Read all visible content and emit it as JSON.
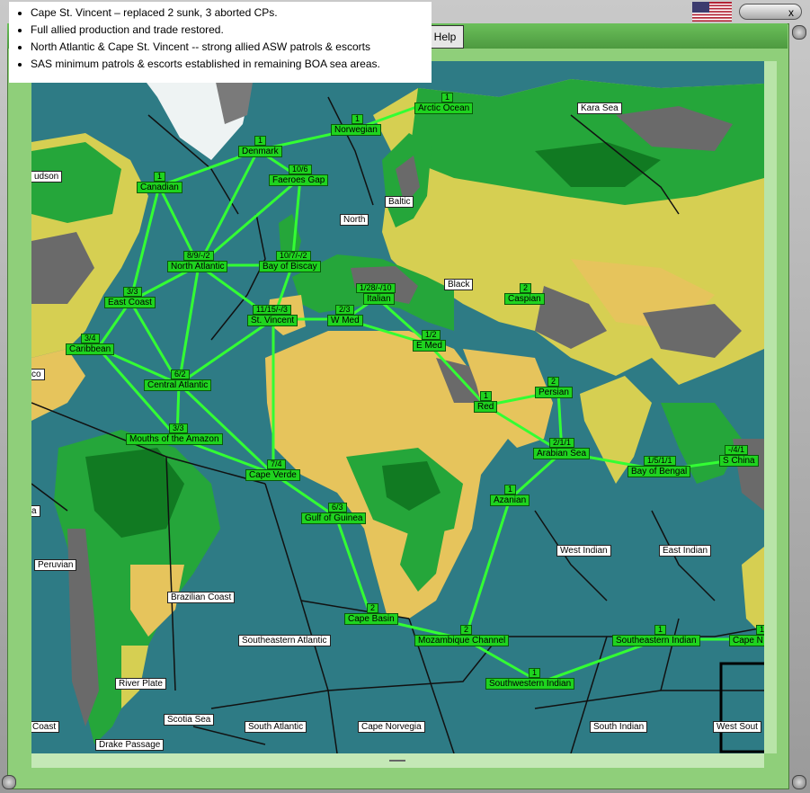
{
  "notes": [
    "Cape St. Vincent – replaced 2 sunk, 3 aborted CPs.",
    "Full allied production and trade restored.",
    "North Atlantic & Cape St. Vincent -- strong allied ASW patrols & escorts",
    "SAS minimum patrols & escorts established in remaining BOA sea areas."
  ],
  "toolbar": {
    "help_label": "Help",
    "close_label": "x"
  },
  "colors": {
    "ocean": "#2e7b85",
    "route": "#33ff33",
    "label_green": "#1fd31f",
    "frame_green": "#8fcf7a"
  },
  "sea_areas": [
    {
      "name": "Arctic Ocean",
      "count": "1"
    },
    {
      "name": "Norwegian",
      "count": "1"
    },
    {
      "name": "Denmark",
      "count": "1"
    },
    {
      "name": "Faeroes Gap",
      "count": "10/6"
    },
    {
      "name": "Canadian",
      "count": "1"
    },
    {
      "name": "North Atlantic",
      "count": "8/9/-/2"
    },
    {
      "name": "Bay of Biscay",
      "count": "10/7/-/2"
    },
    {
      "name": "East Coast",
      "count": "3/3"
    },
    {
      "name": "St. Vincent",
      "count": "11/15/-/3"
    },
    {
      "name": "W Med",
      "count": "2/3"
    },
    {
      "name": "Italian",
      "count": "1/28/-/10"
    },
    {
      "name": "Caspian",
      "count": "2"
    },
    {
      "name": "E Med",
      "count": "1/2"
    },
    {
      "name": "Caribbean",
      "count": "3/4"
    },
    {
      "name": "Central Atlantic",
      "count": "6/2"
    },
    {
      "name": "Mouths of the Amazon",
      "count": "3/3"
    },
    {
      "name": "Cape Verde",
      "count": "7/4"
    },
    {
      "name": "Persian",
      "count": "2"
    },
    {
      "name": "Red",
      "count": "1"
    },
    {
      "name": "Arabian Sea",
      "count": "2/1/1"
    },
    {
      "name": "Bay of Bengal",
      "count": "1/5/1/1"
    },
    {
      "name": "S China",
      "count": "-/4/1"
    },
    {
      "name": "Azanian",
      "count": "1"
    },
    {
      "name": "Gulf of Guinea",
      "count": "6/3"
    },
    {
      "name": "Cape Basin",
      "count": "2"
    },
    {
      "name": "Mozambique Channel",
      "count": "2"
    },
    {
      "name": "Southeastern Indian",
      "count": "1"
    },
    {
      "name": "Southwestern Indian",
      "count": "1"
    },
    {
      "name": "Cape N",
      "count": "1"
    }
  ],
  "plain_areas": [
    "Kara Sea",
    "udson",
    "Baltic",
    "North",
    "Black",
    "co",
    "a",
    "Peruvian",
    "West Indian",
    "East Indian",
    "Brazilian Coast",
    "Southeastern Atlantic",
    "River Plate",
    "Scotia Sea",
    "Coast",
    "Drake Passage",
    "South Atlantic",
    "Cape Norvegia",
    "South Indian",
    "West Sout"
  ]
}
